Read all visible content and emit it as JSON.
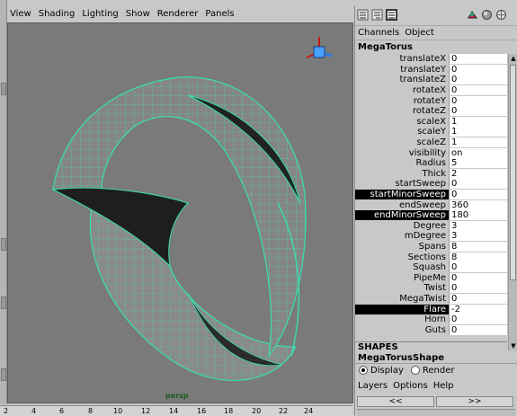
{
  "menubar": [
    "View",
    "Shading",
    "Lighting",
    "Show",
    "Renderer",
    "Panels"
  ],
  "viewport": {
    "camera": "persp",
    "wire_color": "#39e0b0"
  },
  "ruler": [
    "2",
    "4",
    "6",
    "8",
    "10",
    "12",
    "14",
    "16",
    "18",
    "20",
    "22",
    "24"
  ],
  "panel": {
    "menu": [
      "Channels",
      "Object"
    ],
    "node_name": "MegaTorus",
    "channels": [
      {
        "name": "translateX",
        "value": "0"
      },
      {
        "name": "translateY",
        "value": "0"
      },
      {
        "name": "translateZ",
        "value": "0"
      },
      {
        "name": "rotateX",
        "value": "0"
      },
      {
        "name": "rotateY",
        "value": "0"
      },
      {
        "name": "rotateZ",
        "value": "0"
      },
      {
        "name": "scaleX",
        "value": "1"
      },
      {
        "name": "scaleY",
        "value": "1"
      },
      {
        "name": "scaleZ",
        "value": "1"
      },
      {
        "name": "visibility",
        "value": "on"
      },
      {
        "name": "Radius",
        "value": "5"
      },
      {
        "name": "Thick",
        "value": "2"
      },
      {
        "name": "startSweep",
        "value": "0"
      },
      {
        "name": "startMinorSweep",
        "value": "0",
        "selected": true
      },
      {
        "name": "endSweep",
        "value": "360"
      },
      {
        "name": "endMinorSweep",
        "value": "180",
        "selected": true
      },
      {
        "name": "Degree",
        "value": "3"
      },
      {
        "name": "mDegree",
        "value": "3"
      },
      {
        "name": "Spans",
        "value": "8"
      },
      {
        "name": "Sections",
        "value": "8"
      },
      {
        "name": "Squash",
        "value": "0"
      },
      {
        "name": "PipeMe",
        "value": "0"
      },
      {
        "name": "Twist",
        "value": "0"
      },
      {
        "name": "MegaTwist",
        "value": "0"
      },
      {
        "name": "Flare",
        "value": "-2",
        "selected": true
      },
      {
        "name": "Horn",
        "value": "0"
      },
      {
        "name": "Guts",
        "value": "0"
      }
    ],
    "shapes_header": "SHAPES",
    "shapes_sub": "MegaTorusShape",
    "display_label": "Display",
    "render_label": "Render",
    "layers_menu": [
      "Layers",
      "Options",
      "Help"
    ],
    "nav_prev": "<<",
    "nav_next": ">>"
  }
}
